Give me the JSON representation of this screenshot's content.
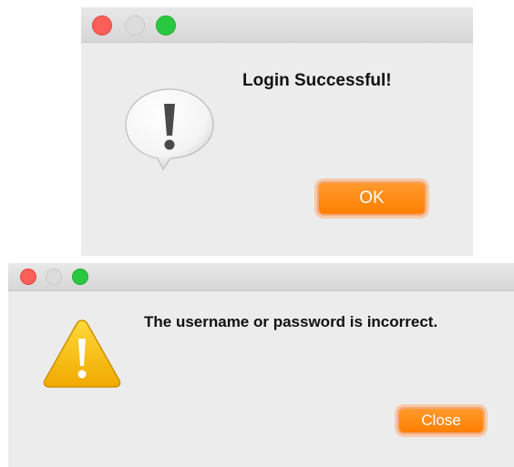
{
  "dialogs": [
    {
      "message": "Login Successful!",
      "button_label": "OK",
      "icon": "speech-bubble-exclamation-icon"
    },
    {
      "message": "The username or password is incorrect.",
      "button_label": "Close",
      "icon": "warning-triangle-icon"
    }
  ],
  "colors": {
    "button": "#ff8300",
    "close_light": "#fc5f57",
    "minimize_light": "#dcdcdc",
    "zoom_light": "#2ac840",
    "warning": "#f5b800"
  }
}
